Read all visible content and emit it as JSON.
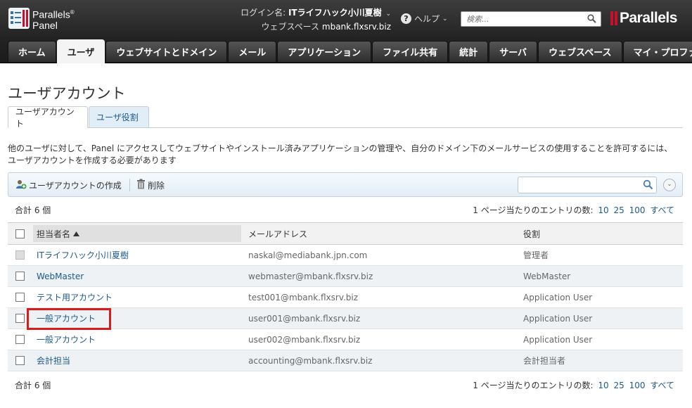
{
  "header": {
    "logo_line1": "Parallels",
    "logo_reg": "®",
    "logo_line2": "Panel",
    "login_label": "ログイン名:",
    "login_value": "ITライフハック小川夏樹",
    "workspace_label": "ウェブスペース",
    "workspace_value": "mbank.flxsrv.biz",
    "help_label": "ヘルプ",
    "search_placeholder": "検索...",
    "brand": "Parallels"
  },
  "nav": {
    "tabs": [
      {
        "label": "ホーム"
      },
      {
        "label": "ユーザ",
        "active": true
      },
      {
        "label": "ウェブサイトとドメイン"
      },
      {
        "label": "メール"
      },
      {
        "label": "アプリケーション"
      },
      {
        "label": "ファイル共有"
      },
      {
        "label": "統計"
      },
      {
        "label": "サーバ"
      },
      {
        "label": "ウェブスペース"
      },
      {
        "label": "マイ・プロファイル"
      }
    ]
  },
  "page": {
    "title": "ユーザアカウント",
    "subtabs": [
      {
        "label": "ユーザアカウント",
        "active": true
      },
      {
        "label": "ユーザ役割"
      }
    ],
    "description": "他のユーザに対して、Panel にアクセスしてウェブサイトやインストール済みアプリケーションの管理や、自分のドメイン下のメールサービスの使用することを許可するには、ユーザアカウントを作成する必要があります"
  },
  "toolbar": {
    "create_label": "ユーザアカウントの作成",
    "delete_label": "削除"
  },
  "list": {
    "total": "合計 6 個",
    "perpage_label": "1 ページ当たりのエントリの数:",
    "perpage_options": [
      "10",
      "25",
      "100",
      "すべて"
    ],
    "columns": {
      "name": "担当者名",
      "email": "メールアドレス",
      "role": "役割"
    },
    "rows": [
      {
        "name": "ITライフハック小川夏樹",
        "email": "naskal@mediabank.jpn.com",
        "role": "管理者"
      },
      {
        "name": "WebMaster",
        "email": "webmaster@mbank.flxsrv.biz",
        "role": "WebMaster"
      },
      {
        "name": "テスト用アカウント",
        "email": "test001@mbank.flxsrv.biz",
        "role": "Application User"
      },
      {
        "name": "一般アカウント",
        "email": "user001@mbank.flxsrv.biz",
        "role": "Application User"
      },
      {
        "name": "一般アカウント",
        "email": "user002@mbank.flxsrv.biz",
        "role": "Application User"
      },
      {
        "name": "会計担当",
        "email": "accounting@mbank.flxsrv.biz",
        "role": "会計担当者"
      }
    ]
  },
  "colors": {
    "link": "#1d5a8e",
    "highlight": "#d81c1c",
    "brand_red": "#c8102e"
  },
  "icons": [
    "parallels-logo-icon",
    "help-icon",
    "search-icon",
    "add-user-icon",
    "trash-icon",
    "expand-icon",
    "sort-ascending-icon"
  ]
}
